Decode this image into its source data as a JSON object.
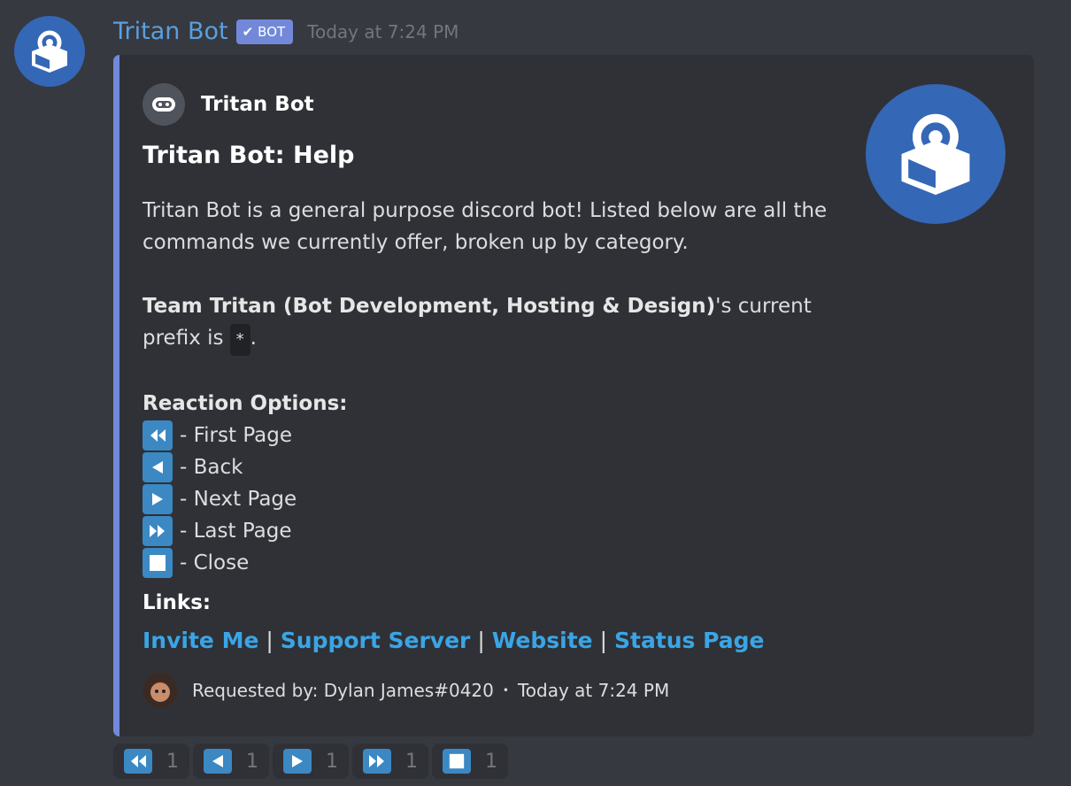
{
  "message": {
    "author": "Tritan Bot",
    "bot_tag": "BOT",
    "timestamp": "Today at 7:24 PM"
  },
  "embed": {
    "author_name": "Tritan Bot",
    "title": "Tritan Bot: Help",
    "description_line1": "Tritan Bot is a general purpose discord bot! Listed below are all the commands we currently offer, broken up by category.",
    "team_name": "Team Tritan (Bot Development, Hosting & Design)",
    "prefix_text_a": "'s current prefix is ",
    "prefix": "*",
    "prefix_text_b": ".",
    "reaction_options_heading": "Reaction Options:",
    "reaction_options": [
      {
        "icon": "rewind-icon",
        "label": "- First Page"
      },
      {
        "icon": "back-icon",
        "label": "- Back"
      },
      {
        "icon": "forward-icon",
        "label": "- Next Page"
      },
      {
        "icon": "fast-forward-icon",
        "label": "- Last Page"
      },
      {
        "icon": "stop-icon",
        "label": "- Close"
      }
    ],
    "links_heading": "Links:",
    "links": {
      "invite": "Invite Me",
      "support": "Support Server",
      "website": "Website",
      "status": "Status Page",
      "separator": "|"
    },
    "footer_text": "Requested by: Dylan James#0420",
    "footer_dot": "•",
    "footer_time": "Today at 7:24 PM",
    "accent_color": "#7289da",
    "link_color": "#3aa5e6"
  },
  "reactions": [
    {
      "icon": "rewind-icon",
      "count": "1"
    },
    {
      "icon": "back-icon",
      "count": "1"
    },
    {
      "icon": "forward-icon",
      "count": "1"
    },
    {
      "icon": "fast-forward-icon",
      "count": "1"
    },
    {
      "icon": "stop-icon",
      "count": "1"
    }
  ]
}
